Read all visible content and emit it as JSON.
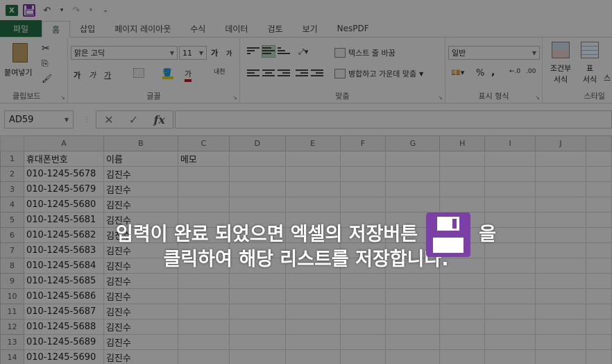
{
  "quick_access": {
    "app_icon_letter": "X",
    "undo_glyph": "↶",
    "redo_glyph": "↷",
    "dropdown_glyph": "▾",
    "customize_glyph": "₌"
  },
  "tabs": [
    {
      "label": "파일",
      "kind": "file"
    },
    {
      "label": "홈",
      "kind": "active"
    },
    {
      "label": "삽입",
      "kind": ""
    },
    {
      "label": "페이지 레이아웃",
      "kind": ""
    },
    {
      "label": "수식",
      "kind": ""
    },
    {
      "label": "데이터",
      "kind": ""
    },
    {
      "label": "검토",
      "kind": ""
    },
    {
      "label": "보기",
      "kind": ""
    },
    {
      "label": "NesPDF",
      "kind": ""
    }
  ],
  "ribbon": {
    "clipboard": {
      "paste_label": "붙여넣기",
      "group_label": "클립보드"
    },
    "font": {
      "font_name": "맑은 고딕",
      "font_size": "11",
      "bold": "가",
      "italic": "가",
      "underline": "가",
      "grow": "가",
      "shrink": "가",
      "font_color_glyph": "가",
      "phonetic": "내천",
      "group_label": "글꼴"
    },
    "alignment": {
      "wrap_text": "텍스트 줄 바꿈",
      "merge_center": "병합하고 가운데 맞춤",
      "group_label": "맞춤"
    },
    "number": {
      "format": "일반",
      "percent": "%",
      "comma": ",",
      "group_label": "표시 형식"
    },
    "styles": {
      "conditional_line1": "조건부",
      "conditional_line2": "서식",
      "table_line1": "표",
      "table_line2": "서식",
      "cell_styles_line2": "스",
      "group_label": "스타일"
    }
  },
  "formula_bar": {
    "name_box": "AD59",
    "cancel_glyph": "✕",
    "enter_glyph": "✓",
    "fx_glyph": "fx",
    "value": ""
  },
  "grid": {
    "columns": [
      "A",
      "B",
      "C",
      "D",
      "E",
      "F",
      "G",
      "H",
      "I",
      "J"
    ],
    "rows": [
      {
        "n": "1",
        "a": "휴대폰번호",
        "b": "이름",
        "c": "메모"
      },
      {
        "n": "2",
        "a": "010-1245-5678",
        "b": "김진수",
        "c": ""
      },
      {
        "n": "3",
        "a": "010-1245-5679",
        "b": "김진수",
        "c": ""
      },
      {
        "n": "4",
        "a": "010-1245-5680",
        "b": "김진수",
        "c": ""
      },
      {
        "n": "5",
        "a": "010-1245-5681",
        "b": "김진수",
        "c": ""
      },
      {
        "n": "6",
        "a": "010-1245-5682",
        "b": "김진수",
        "c": ""
      },
      {
        "n": "7",
        "a": "010-1245-5683",
        "b": "김진수",
        "c": ""
      },
      {
        "n": "8",
        "a": "010-1245-5684",
        "b": "김진수",
        "c": ""
      },
      {
        "n": "9",
        "a": "010-1245-5685",
        "b": "김진수",
        "c": ""
      },
      {
        "n": "10",
        "a": "010-1245-5686",
        "b": "김진수",
        "c": ""
      },
      {
        "n": "11",
        "a": "010-1245-5687",
        "b": "김진수",
        "c": ""
      },
      {
        "n": "12",
        "a": "010-1245-5688",
        "b": "김진수",
        "c": ""
      },
      {
        "n": "13",
        "a": "010-1245-5689",
        "b": "김진수",
        "c": ""
      },
      {
        "n": "14",
        "a": "010-1245-5690",
        "b": "김진수",
        "c": ""
      }
    ]
  },
  "overlay": {
    "line1_before": "입력이 완료 되었으면 엑셀의 저장버튼",
    "line1_after": "을",
    "line2": "클릭하여 해당 리스트를 저장합니다."
  },
  "colors": {
    "excel_green": "#217346",
    "save_purple": "#7b3fa6"
  }
}
